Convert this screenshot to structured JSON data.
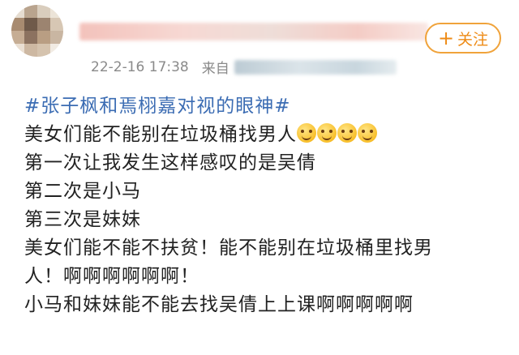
{
  "colors": {
    "accent": "#f0a33b",
    "hashtag": "#3b6cb3",
    "meta_text": "#8a8a8a",
    "body_text": "#222222"
  },
  "header": {
    "follow_button": {
      "icon": "plus-icon",
      "label": "关注"
    },
    "timestamp": "22-2-16 17:38",
    "source_prefix": "来自"
  },
  "post": {
    "hashtag": "#张子枫和焉栩嘉对视的眼神#",
    "lines": [
      "美女们能不能别在垃圾桶找男人",
      "第一次让我发生这样感叹的是吴倩",
      "第二次是小马",
      "第三次是妹妹",
      "美女们能不能不扶贫！能不能别在垃圾桶里找男",
      "人！啊啊啊啊啊啊！",
      "小马和妹妹能不能去找吴倩上上课啊啊啊啊啊"
    ],
    "emoji_icon": "grinning-face-emoji",
    "emoji_count": 4
  }
}
